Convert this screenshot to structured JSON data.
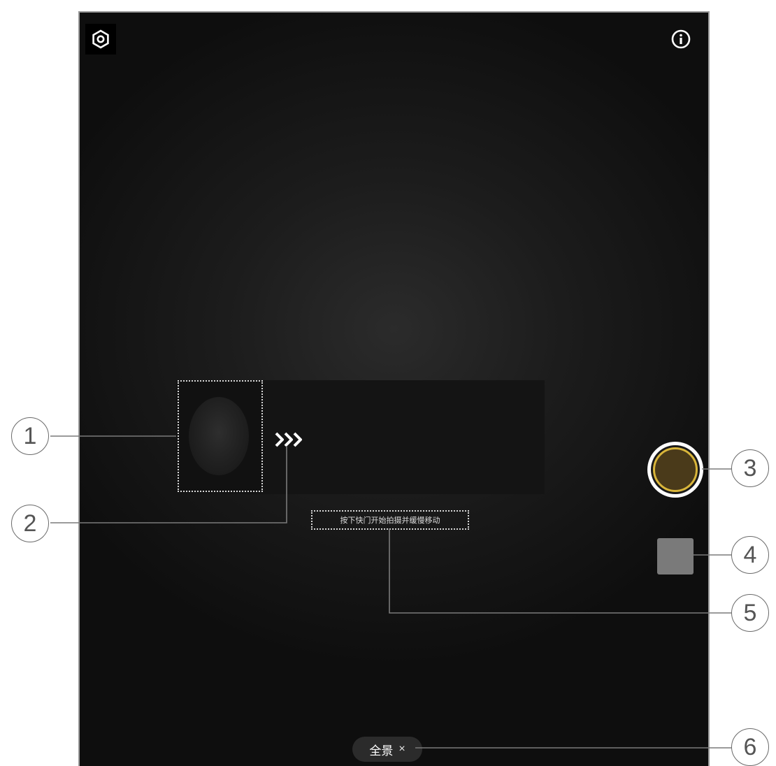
{
  "camera_screen": {
    "top_bar": {
      "settings_icon": "gear-icon",
      "info_icon": "info-icon"
    },
    "panorama": {
      "preview_frame_label": "1",
      "direction_arrows": "»»»",
      "hint_text": "按下快门开始拍摄并缓慢移动"
    },
    "controls": {
      "shutter_icon": "shutter-button",
      "gallery_thumbnail_icon": "gallery-thumbnail"
    },
    "mode_chip": {
      "label": "全景",
      "close_symbol": "×"
    },
    "colors": {
      "accent": "#d9b53a",
      "background": "#1a1a1a",
      "thumbnail": "#7a7a7a"
    }
  },
  "callouts": [
    "1",
    "2",
    "3",
    "4",
    "5",
    "6"
  ]
}
